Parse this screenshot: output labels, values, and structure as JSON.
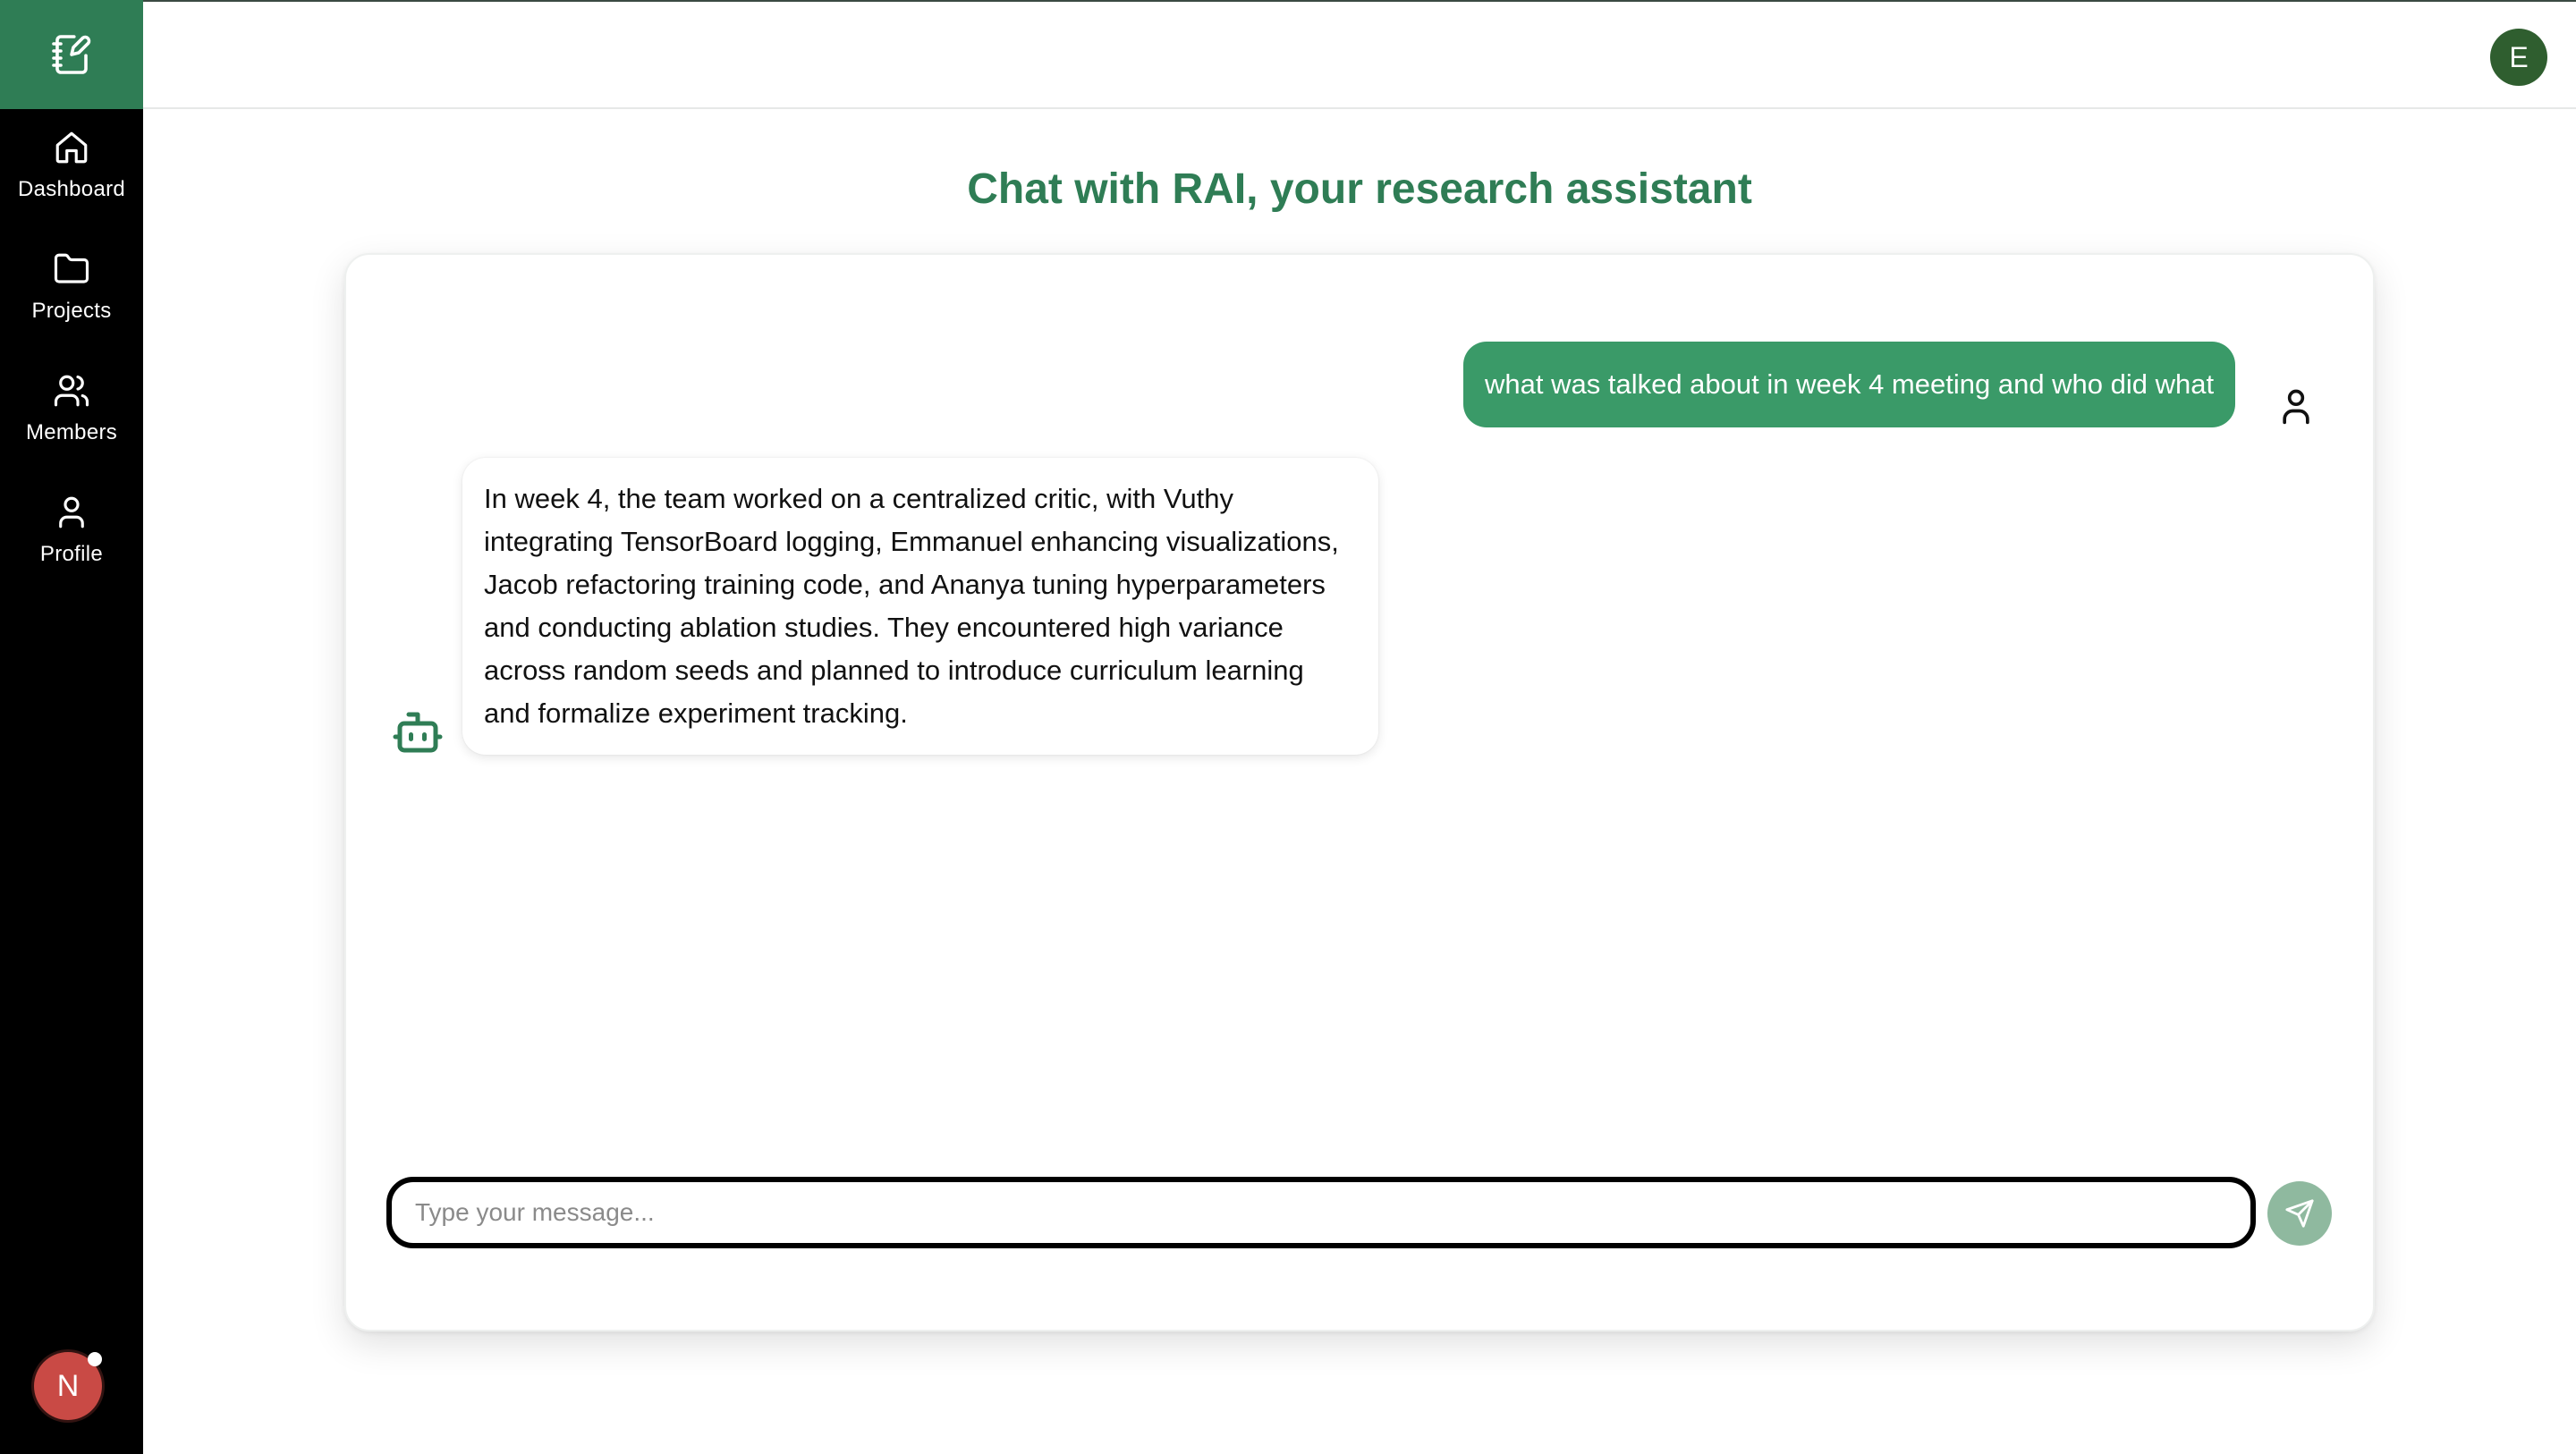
{
  "sidebar": {
    "logo_icon": "notebook-pen-icon",
    "items": [
      {
        "label": "Dashboard",
        "icon": "home-icon"
      },
      {
        "label": "Projects",
        "icon": "folder-icon"
      },
      {
        "label": "Members",
        "icon": "users-icon"
      },
      {
        "label": "Profile",
        "icon": "user-icon"
      }
    ],
    "bottom_avatar": {
      "initial": "N",
      "color": "#c94a45",
      "has_notification": true
    }
  },
  "header": {
    "user_avatar": {
      "initial": "E",
      "color": "#2f5e2f"
    }
  },
  "page": {
    "title": "Chat with RAI, your research assistant"
  },
  "chat": {
    "messages": [
      {
        "role": "user",
        "text": "what was talked about in week 4 meeting and who did what",
        "icon": "user-icon"
      },
      {
        "role": "assistant",
        "text": "In week 4, the team worked on a centralized critic, with Vuthy integrating TensorBoard logging, Emmanuel enhancing visualizations, Jacob refactoring training code, and Ananya tuning hyperparameters and conducting ablation studies. They encountered high variance across random seeds and planned to introduce curriculum learning and formalize experiment tracking.",
        "icon": "bot-icon"
      }
    ],
    "input": {
      "placeholder": "Type your message...",
      "value": ""
    },
    "send_icon": "send-icon"
  },
  "colors": {
    "brand": "#2f7d55",
    "user_bubble": "#3a9a68",
    "send_button": "#8fb99f",
    "sidebar_bg": "#000000"
  }
}
